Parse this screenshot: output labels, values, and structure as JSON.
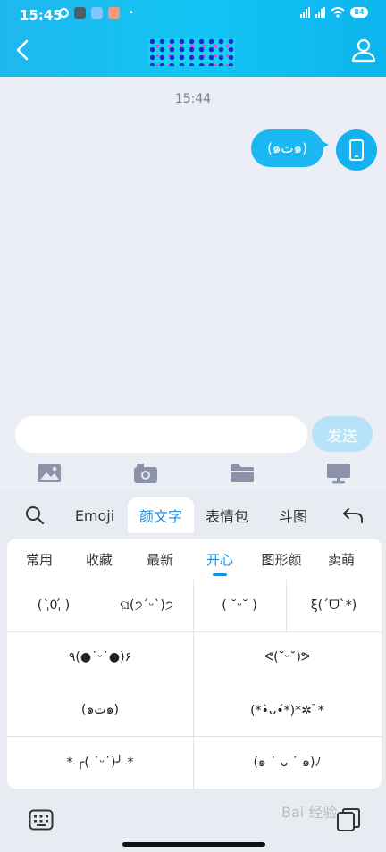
{
  "status_bar": {
    "time": "15:45",
    "battery": "84",
    "left_icons": [
      "alarm-icon",
      "app-icon",
      "app-icon",
      "app-icon"
    ],
    "right_icons": [
      "signal-icon",
      "signal-icon",
      "wifi-icon",
      "battery-icon"
    ]
  },
  "chat": {
    "timestamp": "15:44",
    "message": "(๑ت๑)"
  },
  "input": {
    "placeholder": "",
    "value": "",
    "send_label": "发送"
  },
  "tools": [
    "image-icon",
    "camera-icon",
    "folder-icon",
    "monitor-icon"
  ],
  "categories": {
    "emoji": "Emoji",
    "kaomoji": "颜文字",
    "stickers": "表情包",
    "doutu": "斗图",
    "selected": "颜文字"
  },
  "tabs": [
    "常用",
    "收藏",
    "最新",
    "开心",
    "图形颜",
    "卖萌"
  ],
  "selected_tab": "开心",
  "kaomoji": {
    "r1c1": "( ˌ̀0ˌ́ )",
    "r1c2": "ଘ(੭ˊᵕˋ)੭",
    "r1c3": "( ˘ᵕ˘ )",
    "r1c4": "ξ(´ᗜ`*)",
    "r2c1": "٩(●˙ᵕ˙●)۶",
    "r2c2": "ᕙ(˘ᵕ˘)ᕗ",
    "r3c1": "(๑ت๑)",
    "r3c2": "(*•̀ᴗ•́*)*✲ﾟ*",
    "r4c1": "*  ╭( ˙ᵕ˙)╯ *",
    "r4c2": "(๑ ˙ ᴗ ˙ ๑)ﾉ"
  },
  "watermark": "Bai 经验"
}
